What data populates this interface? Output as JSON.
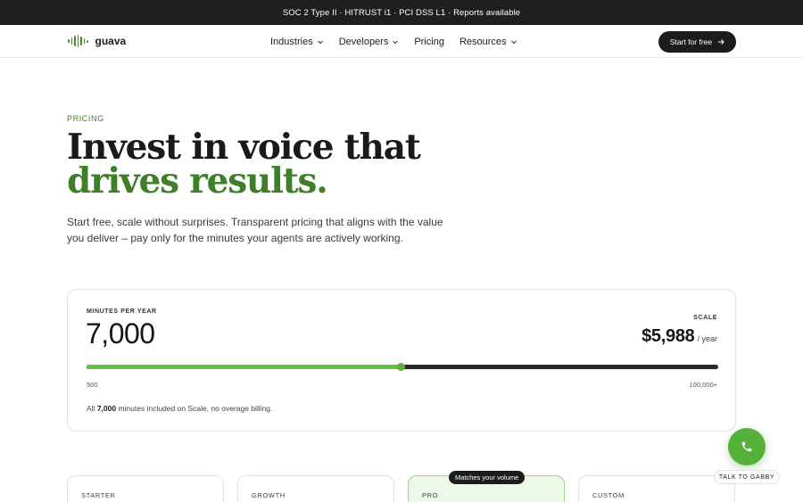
{
  "announcement": "SOC 2 Type II · HITRUST i1 · PCI DSS L1 · Reports available",
  "nav": {
    "logo_text": "guava",
    "links": [
      {
        "label": "Industries",
        "has_dropdown": true
      },
      {
        "label": "Developers",
        "has_dropdown": true
      },
      {
        "label": "Pricing",
        "has_dropdown": false
      },
      {
        "label": "Resources",
        "has_dropdown": true
      }
    ],
    "cta_label": "Start for free"
  },
  "hero": {
    "eyebrow": "PRICING",
    "title_line1": "Invest in voice that",
    "title_line2": "drives results.",
    "subtitle": "Start free, scale without surprises. Transparent pricing that aligns with the value you deliver – pay only for the minutes your agents are actively working."
  },
  "calculator": {
    "minutes_label": "MINUTES PER YEAR",
    "minutes_value": "7,000",
    "plan_label": "SCALE",
    "price": "$5,988",
    "price_period": "/ year",
    "slider": {
      "min_label": "500",
      "max_label": "100,000+",
      "position": 0.498
    },
    "note_prefix": "All ",
    "note_minutes": "7,000",
    "note_suffix": " minutes included on Scale, no overage billing."
  },
  "plans": [
    {
      "name": "STARTER",
      "highlighted": false
    },
    {
      "name": "GROWTH",
      "highlighted": false
    },
    {
      "name": "PRO",
      "highlighted": true
    },
    {
      "name": "CUSTOM",
      "highlighted": false
    }
  ],
  "match_badge": "Matches your volume",
  "talk_widget": {
    "label": "TALK TO GABBY"
  },
  "colors": {
    "accent_green": "#3f7f2a",
    "slider_green": "#67bd45",
    "dark": "#1c1c1c"
  },
  "icons": {
    "logo": "waveform-icon",
    "dropdown": "chevron-down-icon",
    "cta": "arrow-right-icon",
    "call": "phone-icon"
  }
}
